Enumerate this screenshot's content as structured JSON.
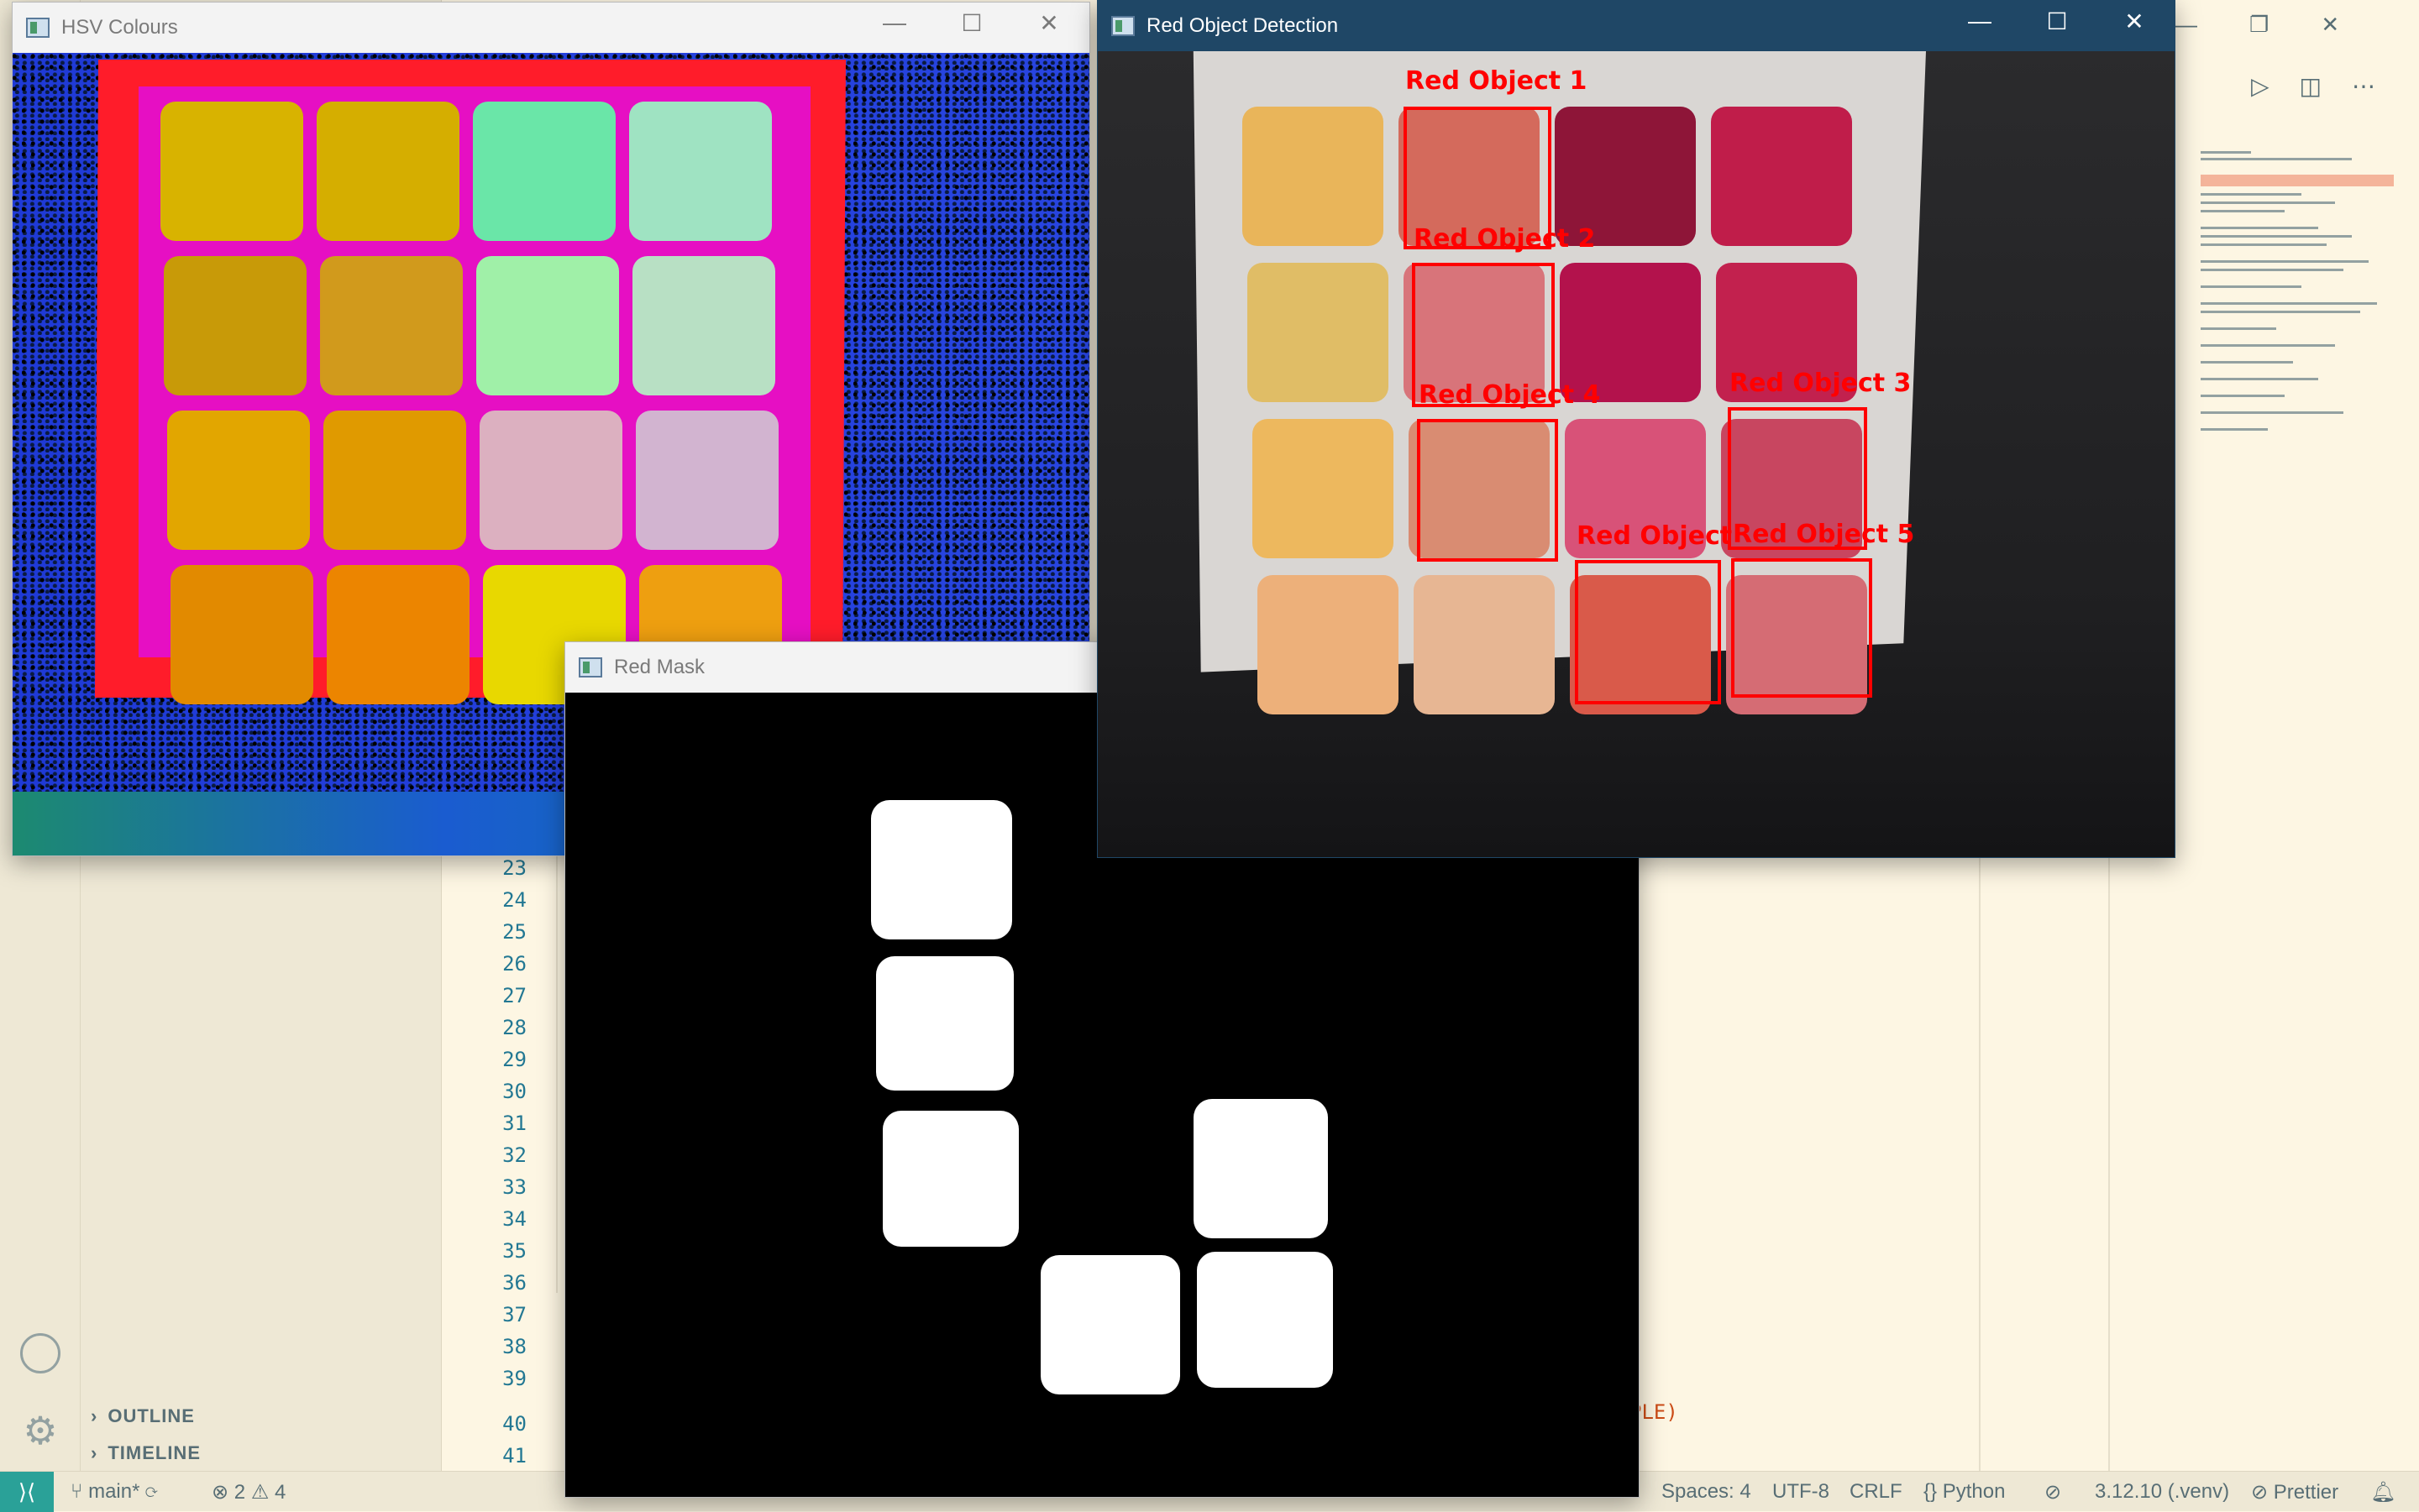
{
  "vscode": {
    "line_numbers": [
      "23",
      "24",
      "25",
      "26",
      "27",
      "28",
      "29",
      "30",
      "31",
      "32",
      "33",
      "34",
      "35",
      "36",
      "37",
      "38",
      "39",
      "40",
      "41"
    ],
    "panels": {
      "outline": "OUTLINE",
      "timeline": "TIMELINE"
    },
    "code_fragment": "PLE)",
    "status": {
      "branch": "main*",
      "errors": "2",
      "warnings": "4",
      "spaces": "Spaces: 4",
      "encoding": "UTF-8",
      "eol": "CRLF",
      "language": "{} Python",
      "interpreter": "3.12.10 (.venv)",
      "formatter": "Prettier"
    }
  },
  "windows": {
    "hsv": {
      "title": "HSV Colours"
    },
    "mask": {
      "title": "Red Mask"
    },
    "detection": {
      "title": "Red Object Detection",
      "labels": [
        "Red Object 1",
        "Red Object 2",
        "Red Object 3",
        "Red Object 4",
        "Red Object",
        "Red Object 5"
      ]
    }
  },
  "colors": {
    "hsv_squares": [
      "#d8b300",
      "#d5ae00",
      "#6ae6a8",
      "#9fe3c2",
      "#c89a08",
      "#d19a1c",
      "#a0f0a8",
      "#b8e0c4",
      "#e2a600",
      "#e09a00",
      "#dcb0c0",
      "#d2b4d0",
      "#e28a00",
      "#ec8500",
      "#e8d800",
      "#ee9f10"
    ],
    "card_squares": [
      "#e9b55a",
      "#d46a5c",
      "#8e1538",
      "#c01d4a",
      "#e0bd66",
      "#d8747a",
      "#b3124c",
      "#c2214e",
      "#edb85e",
      "#d98c72",
      "#d85278",
      "#c84660",
      "#edb07a",
      "#e7b693",
      "#d95a4a",
      "#d56c74"
    ]
  }
}
